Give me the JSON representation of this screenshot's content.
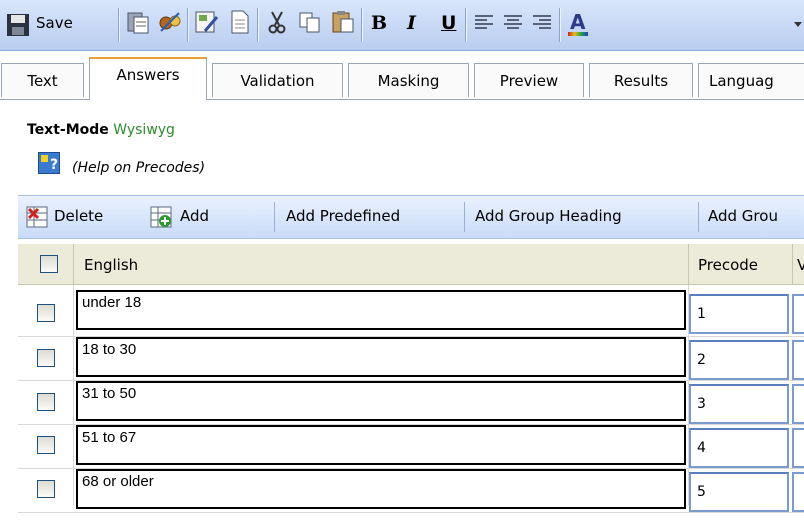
{
  "toolbar": {
    "save_label": "Save",
    "bold_label": "B",
    "italic_label": "I",
    "underline_label": "U",
    "font_color_label": "A"
  },
  "tabs": [
    {
      "label": "Text"
    },
    {
      "label": "Answers"
    },
    {
      "label": "Validation"
    },
    {
      "label": "Masking"
    },
    {
      "label": "Preview"
    },
    {
      "label": "Results"
    },
    {
      "label": "Languag"
    }
  ],
  "mode": {
    "label": "Text-Mode",
    "alt": "Wysiwyg"
  },
  "help": {
    "text": "(Help on Precodes)"
  },
  "grid_toolbar": {
    "delete": "Delete",
    "add": "Add",
    "add_predefined": "Add Predefined",
    "add_group_heading": "Add Group Heading",
    "add_group": "Add Grou"
  },
  "table": {
    "headers": {
      "english": "English",
      "precode": "Precode",
      "next": "V"
    },
    "rows": [
      {
        "english": "under 18",
        "precode": "1"
      },
      {
        "english": "18 to 30",
        "precode": "2"
      },
      {
        "english": "31 to 50",
        "precode": "3"
      },
      {
        "english": "51 to 67",
        "precode": "4"
      },
      {
        "english": "68 or older",
        "precode": "5"
      }
    ]
  }
}
